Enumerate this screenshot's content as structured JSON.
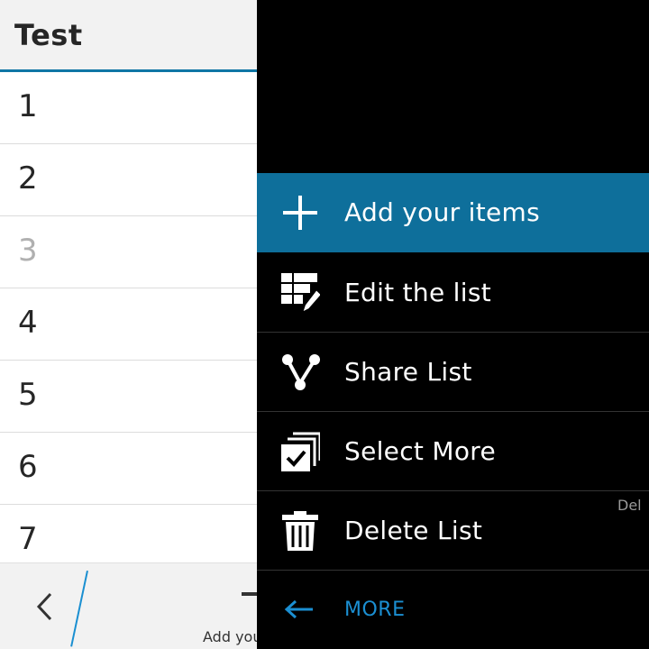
{
  "app": {
    "title": "Test"
  },
  "list": {
    "items": [
      "1",
      "2",
      "3",
      "4",
      "5",
      "6",
      "7"
    ]
  },
  "action_bar": {
    "add_label": "Add you"
  },
  "menu": {
    "items": [
      {
        "label": "Add your items",
        "icon": "plus-icon",
        "active": true
      },
      {
        "label": "Edit the list",
        "icon": "edit-list-icon"
      },
      {
        "label": "Share List",
        "icon": "share-icon"
      },
      {
        "label": "Select More",
        "icon": "select-more-icon"
      },
      {
        "label": "Delete List",
        "icon": "trash-icon"
      }
    ],
    "del_hint": "Del",
    "more_label": "MORE"
  },
  "colors": {
    "accent": "#0e6f9b",
    "link": "#1b8fd2",
    "menu_bg": "#000000"
  }
}
